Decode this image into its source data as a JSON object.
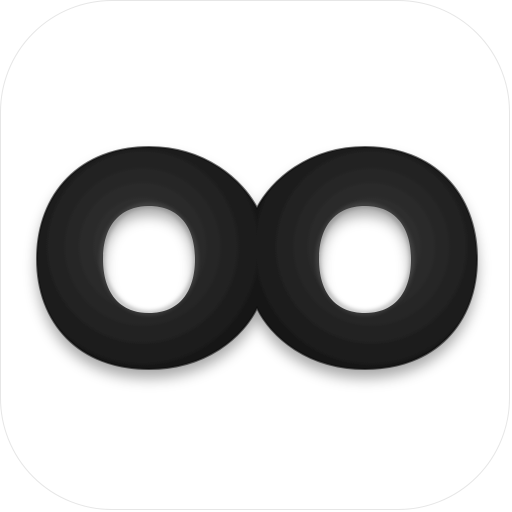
{
  "app_icon": {
    "icon": "infinity-icon",
    "colors": {
      "tile_background": "#ffffff",
      "tile_border": "#e6e6e6",
      "glyph_dark": "#161616",
      "glyph_mid": "#2c2c2c",
      "glyph_edge": "#4a4a4a"
    }
  }
}
